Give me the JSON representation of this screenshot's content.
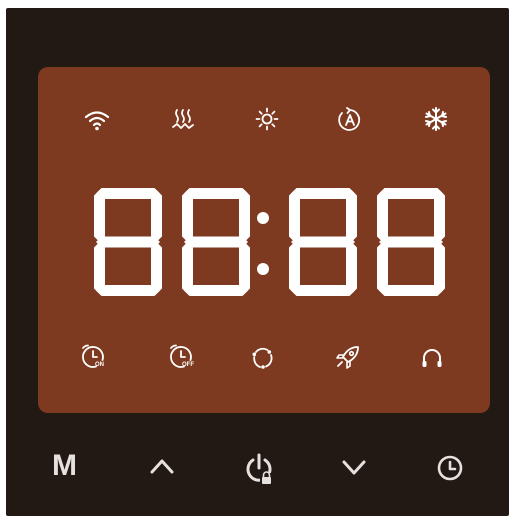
{
  "colors": {
    "panel": "#221814",
    "screen": "#7e3a20",
    "segment": "#ffffff",
    "button": "#e6e1de"
  },
  "display": {
    "time_text": "88:88"
  },
  "top_indicators": [
    {
      "name": "wifi-icon"
    },
    {
      "name": "floor-heating-icon"
    },
    {
      "name": "sun-icon"
    },
    {
      "name": "auto-mode-icon"
    },
    {
      "name": "snowflake-icon"
    }
  ],
  "bottom_indicators": [
    {
      "name": "timer-on-icon",
      "label": "ON"
    },
    {
      "name": "timer-off-icon",
      "label": "OFF"
    },
    {
      "name": "cycle-icon"
    },
    {
      "name": "rocket-icon"
    },
    {
      "name": "headphones-icon"
    }
  ],
  "buttons": {
    "mode_label": "M",
    "up": "chevron-up-icon",
    "power_lock": "power-lock-icon",
    "down": "chevron-down-icon",
    "clock": "clock-icon"
  }
}
